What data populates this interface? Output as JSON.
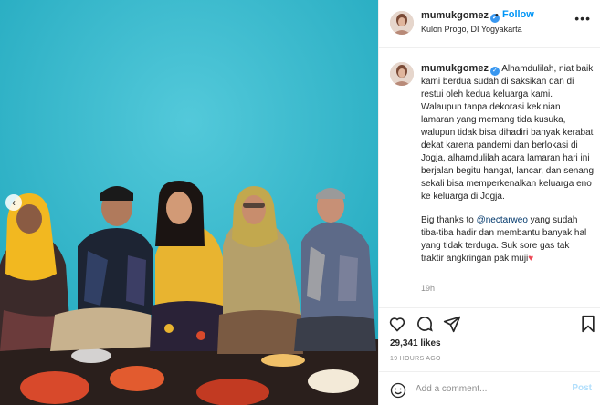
{
  "post": {
    "username": "mumukgomez",
    "follow_label": "Follow",
    "dot": "•",
    "location": "Kulon Progo, DI Yogyakarta",
    "more_glyph": "•••",
    "prev_glyph": "‹",
    "verified_glyph": "✓"
  },
  "caption": {
    "username": "mumukgomez",
    "text_1": "Alhamdulilah, niat baik kami berdua sudah di saksikan dan di restui oleh kedua keluarga kami. Walaupun tanpa dekorasi kekinian lamaran yang memang tida kusuka, walupun tidak bisa dihadiri banyak kerabat dekat karena pandemi dan berlokasi di Jogja, alhamdulilah acara lamaran hari ini berjalan begitu hangat, lancar, dan senang sekali bisa memperkenalkan keluarga eno ke keluarga di Jogja.",
    "text_2_prefix": "Big thanks to ",
    "mention": "@nectarweo",
    "text_2_suffix": " yang sudah tiba-tiba hadir dan membantu banyak hal yang tidak terduga. Suk sore gas tak traktir angkringan pak muji",
    "heart": "♥",
    "time_ago": "19h"
  },
  "engagement": {
    "likes": "29,341 likes",
    "post_date": "19 HOURS AGO"
  },
  "comment": {
    "placeholder": "Add a comment...",
    "post_label": "Post"
  },
  "icons": {
    "heart": "heart-icon",
    "comment": "comment-icon",
    "share": "share-icon",
    "save": "bookmark-icon",
    "emoji": "emoji-icon"
  },
  "colors": {
    "link": "#0095f6",
    "wall": "#2fb6c8",
    "muted": "#8e8e8e"
  }
}
